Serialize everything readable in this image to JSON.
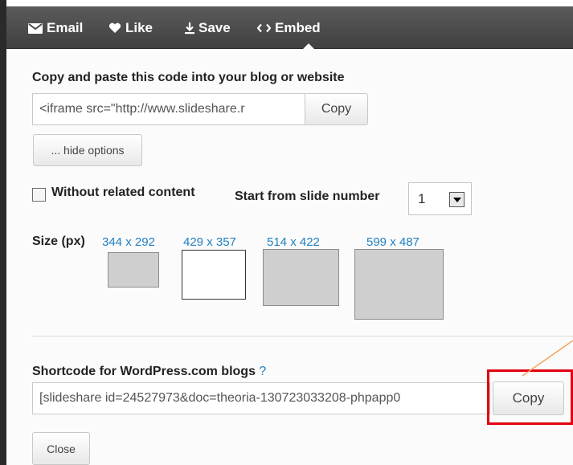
{
  "tabs": [
    {
      "label": "Email",
      "icon": "email-icon"
    },
    {
      "label": "Like",
      "icon": "heart-icon"
    },
    {
      "label": "Save",
      "icon": "download-icon"
    },
    {
      "label": "Embed",
      "icon": "code-icon"
    }
  ],
  "embed": {
    "heading": "Copy and paste this code into your blog or website",
    "code_value": "<iframe src=\"http://www.slideshare.r",
    "copy_label": "Copy",
    "hide_options_label": "... hide options"
  },
  "options": {
    "without_related_label": "Without related content",
    "without_related_checked": false,
    "start_slide_label": "Start from slide number",
    "start_slide_value": "1"
  },
  "size": {
    "label": "Size (px)",
    "options": [
      "344 x 292",
      "429 x 357",
      "514 x 422",
      "599 x 487"
    ],
    "selected": "429 x 357"
  },
  "shortcode": {
    "heading": "Shortcode for WordPress.com blogs",
    "help": "?",
    "value": "[slideshare id=24527973&doc=theoria-130723033208-phpapp0",
    "copy_label": "Copy"
  },
  "close_label": "Close",
  "colors": {
    "tabbar": "#4a4a4a",
    "link": "#1f7fc2",
    "highlight": "#e3000f",
    "annotation_line": "#f5a25d"
  }
}
